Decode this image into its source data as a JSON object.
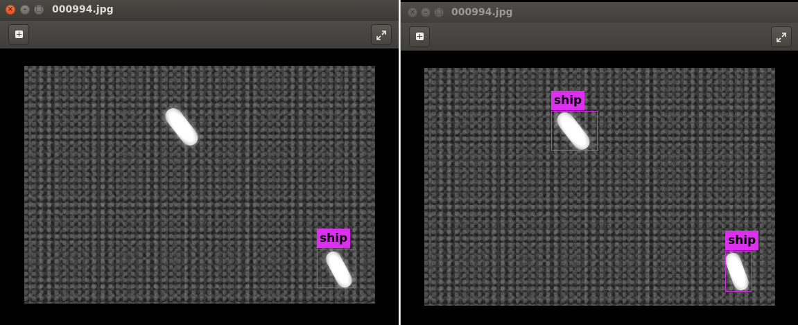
{
  "windows": {
    "left": {
      "title": "000994.jpg",
      "detections": [
        {
          "label": "ship"
        }
      ]
    },
    "right": {
      "title": "000994.jpg",
      "detections": [
        {
          "label": "ship"
        },
        {
          "label": "ship"
        }
      ]
    }
  },
  "icons": {
    "close": "close-icon",
    "minimize": "minimize-icon",
    "maximize": "maximize-icon",
    "add": "add-icon",
    "expand": "expand-icon"
  },
  "colors": {
    "bbox": "#d02ee0",
    "label_bg": "#dd2ff0",
    "titlebar": "#3b3a36",
    "close_button": "#e2531e"
  }
}
